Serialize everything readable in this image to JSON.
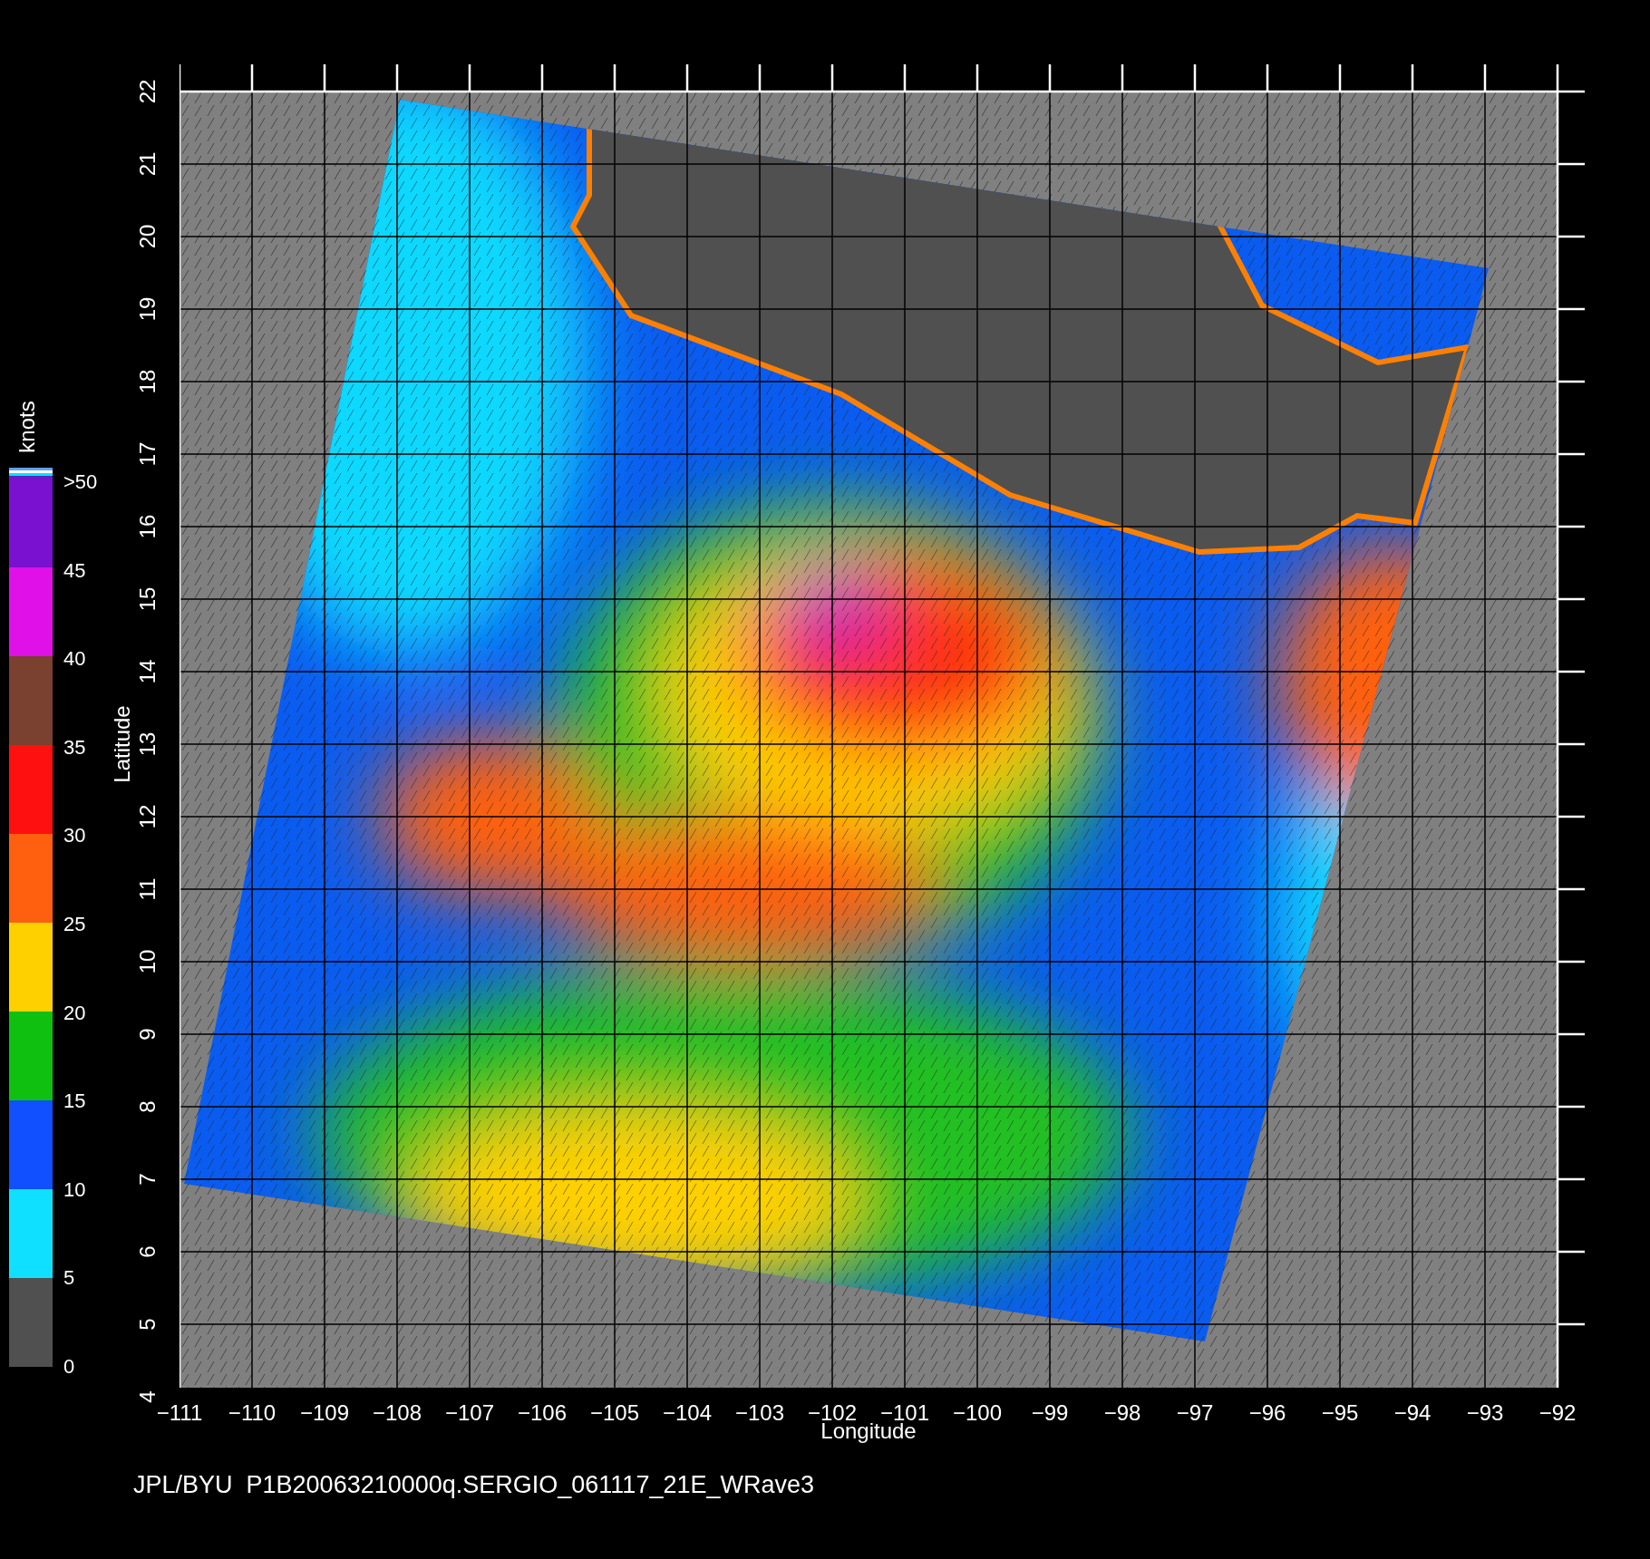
{
  "colorbar": {
    "unit": "knots",
    "segments": [
      {
        "color": "#7a10d0"
      },
      {
        "color": "#e010e8"
      },
      {
        "color": "#7a4030"
      },
      {
        "color": "#ff1010"
      },
      {
        "color": "#ff6010"
      },
      {
        "color": "#ffd000"
      },
      {
        "color": "#10c010"
      },
      {
        "color": "#1050ff"
      },
      {
        "color": "#10e0ff"
      },
      {
        "color": "#505050"
      }
    ],
    "labels": [
      ">50",
      "45",
      "40",
      "35",
      "30",
      "25",
      "20",
      "15",
      "10",
      "5",
      "0"
    ]
  },
  "y_axis": {
    "label": "Latitude",
    "ticks": [
      "22",
      "21",
      "20",
      "19",
      "18",
      "17",
      "16",
      "15",
      "14",
      "13",
      "12",
      "11",
      "10",
      "9",
      "8",
      "7",
      "6",
      "5",
      "4"
    ]
  },
  "x_axis": {
    "label": "Longitude",
    "ticks": [
      "−111",
      "−110",
      "−109",
      "−108",
      "−107",
      "−106",
      "−105",
      "−104",
      "−103",
      "−102",
      "−101",
      "−100",
      "−99",
      "−98",
      "−97",
      "−96",
      "−95",
      "−94",
      "−93",
      "−92"
    ]
  },
  "footer": "JPL/BYU  P1B20063210000q.SERGIO_061117_21E_WRave3"
}
